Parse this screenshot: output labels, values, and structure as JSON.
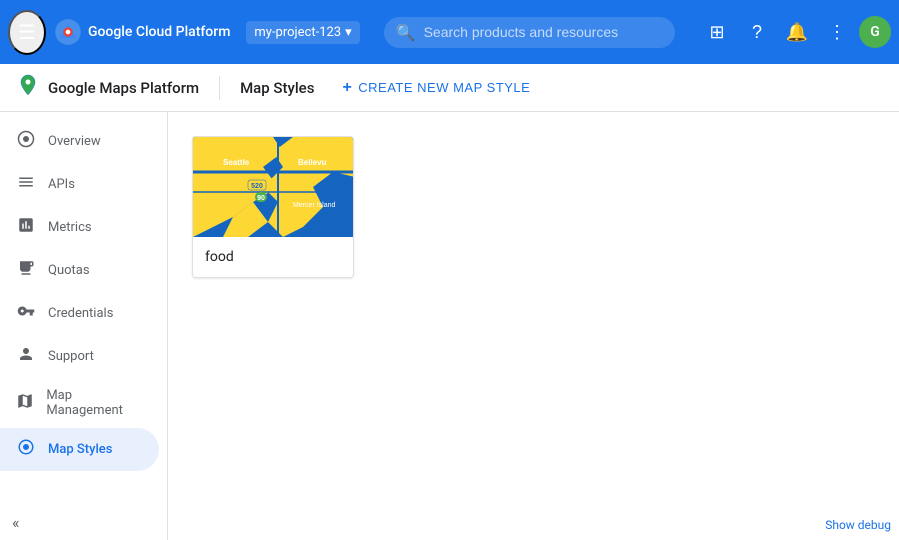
{
  "topbar": {
    "menu_icon": "☰",
    "title": "Google Cloud Platform",
    "project_name": "my-project-123",
    "search_placeholder": "Search products and resources",
    "dropdown_icon": "▾",
    "icons": {
      "apps": "⊞",
      "help": "?",
      "notifications": "🔔",
      "more": "⋮"
    },
    "avatar_label": "G"
  },
  "second_header": {
    "logo_icon": "📍",
    "brand": "Google Maps Platform",
    "divider": true,
    "page_title": "Map Styles",
    "create_button": "CREATE NEW MAP STYLE"
  },
  "sidebar": {
    "items": [
      {
        "id": "overview",
        "label": "Overview",
        "icon": "⊙"
      },
      {
        "id": "apis",
        "label": "APIs",
        "icon": "☰"
      },
      {
        "id": "metrics",
        "label": "Metrics",
        "icon": "📊"
      },
      {
        "id": "quotas",
        "label": "Quotas",
        "icon": "▤"
      },
      {
        "id": "credentials",
        "label": "Credentials",
        "icon": "🔑"
      },
      {
        "id": "support",
        "label": "Support",
        "icon": "👤"
      },
      {
        "id": "map-management",
        "label": "Map Management",
        "icon": "▦"
      },
      {
        "id": "map-styles",
        "label": "Map Styles",
        "icon": "◎",
        "active": true
      }
    ],
    "collapse_icon": "«"
  },
  "main": {
    "cards": [
      {
        "id": "food",
        "label": "food",
        "map_alt": "Map preview showing Seattle area with blue and yellow colors"
      }
    ]
  },
  "footer": {
    "show_debug": "Show debug"
  }
}
